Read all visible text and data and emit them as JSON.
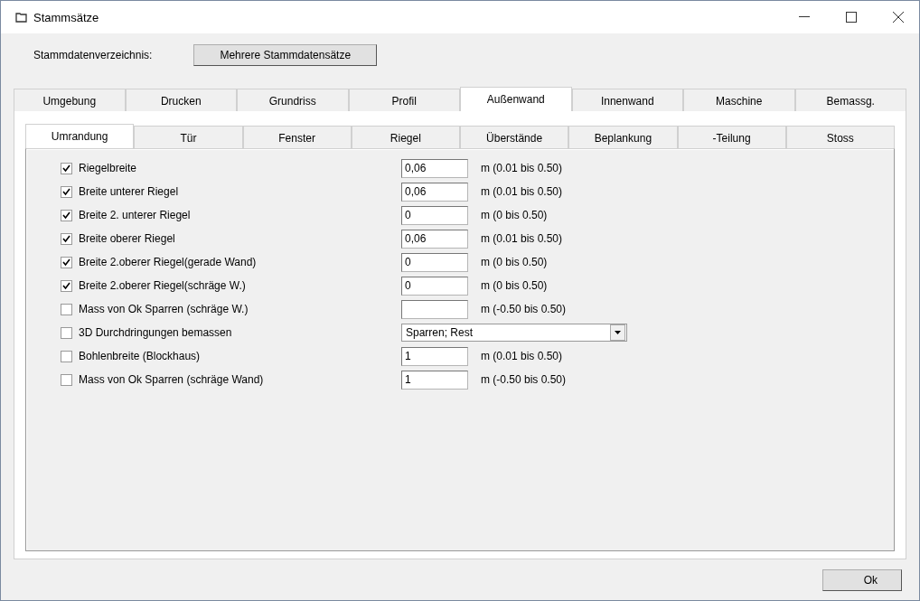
{
  "window": {
    "title": "Stammsätze"
  },
  "directory": {
    "label": "Stammdatenverzeichnis:",
    "button": "Mehrere Stammdatensätze"
  },
  "tabs": [
    {
      "label": "Umgebung",
      "selected": false
    },
    {
      "label": "Drucken",
      "selected": false
    },
    {
      "label": "Grundriss",
      "selected": false
    },
    {
      "label": "Profil",
      "selected": false
    },
    {
      "label": "Außenwand",
      "selected": true
    },
    {
      "label": "Innenwand",
      "selected": false
    },
    {
      "label": "Maschine",
      "selected": false
    },
    {
      "label": "Bemassg.",
      "selected": false
    }
  ],
  "subtabs": [
    {
      "label": "Umrandung",
      "selected": true
    },
    {
      "label": "Tür",
      "selected": false
    },
    {
      "label": "Fenster",
      "selected": false
    },
    {
      "label": "Riegel",
      "selected": false
    },
    {
      "label": "Überstände",
      "selected": false
    },
    {
      "label": "Beplankung",
      "selected": false
    },
    {
      "label": "-Teilung",
      "selected": false
    },
    {
      "label": "Stoss",
      "selected": false
    }
  ],
  "rows": [
    {
      "kind": "text",
      "label": "Riegelbreite",
      "checked": true,
      "value": "0,06",
      "range": "m (0.01 bis 0.50)"
    },
    {
      "kind": "text",
      "label": "Breite unterer Riegel",
      "checked": true,
      "value": "0,06",
      "range": "m (0.01 bis 0.50)"
    },
    {
      "kind": "text",
      "label": "Breite 2. unterer Riegel",
      "checked": true,
      "value": "0",
      "range": "m (0 bis 0.50)"
    },
    {
      "kind": "text",
      "label": "Breite oberer Riegel",
      "checked": true,
      "value": "0,06",
      "range": "m (0.01 bis 0.50)"
    },
    {
      "kind": "text",
      "label": "Breite 2.oberer Riegel(gerade Wand)",
      "checked": true,
      "value": "0",
      "range": "m (0 bis 0.50)"
    },
    {
      "kind": "text",
      "label": "Breite 2.oberer Riegel(schräge W.)",
      "checked": true,
      "value": "0",
      "range": "m (0 bis 0.50)"
    },
    {
      "kind": "text",
      "label": "Mass von Ok Sparren (schräge W.)",
      "checked": false,
      "range": "m (-0.50 bis 0.50)"
    },
    {
      "kind": "select",
      "label": "3D Durchdringungen bemassen",
      "checked": false,
      "value": "Sparren; Rest"
    },
    {
      "kind": "text",
      "label": "Bohlenbreite (Blockhaus)",
      "checked": false,
      "value": "1",
      "range": "m (0.01 bis 0.50)"
    },
    {
      "kind": "text",
      "label": "Mass von Ok Sparren (schräge Wand)",
      "checked": false,
      "value": "1",
      "range": "m (-0.50 bis 0.50)"
    }
  ],
  "ok_button": "Ok"
}
